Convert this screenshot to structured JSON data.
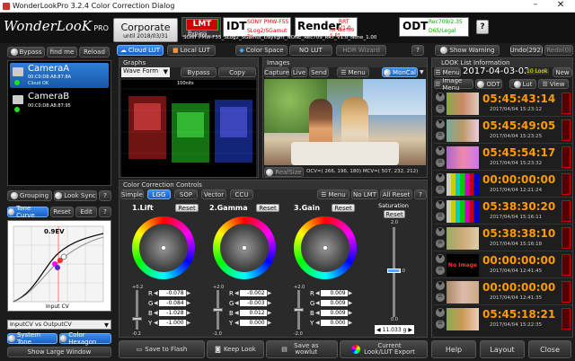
{
  "window": {
    "title": "WonderLookPro 3.2.4 Color Correction Dialog"
  },
  "brand": {
    "name": "WonderLooK",
    "suffix": "PRO"
  },
  "header": {
    "project": "Corporate",
    "expiry": "until 2018/03/31",
    "lmt": {
      "label": "LMT",
      "value": "Bypass"
    },
    "idt": {
      "label": "IDT",
      "line1": "SONY PMW-F55",
      "line2": "SLog2/SGamut DL"
    },
    "render": {
      "label": "Render",
      "line1": "RRT V1.0",
      "line2": "for Rec709 & P3"
    },
    "odt": {
      "label": "ODT",
      "line1": "Rec709/2.35",
      "line2": "D65/Legal"
    },
    "pipeline": "SONY PMW-F55_SLog2_SGamut_Daylight_NONE_Rec709_RRT_V1.0_None_1.00",
    "help": "?"
  },
  "topright": {
    "show_warning": "Show Warning",
    "undo": "Undo(292)",
    "redo": "Redo(0)"
  },
  "left": {
    "bypass": "Bypass",
    "findme": "find me",
    "reload": "Reload",
    "cameras": [
      {
        "name": "CameraA",
        "mac": "00:C0:D8:A8:87:8A",
        "status": "Cloud OK"
      },
      {
        "name": "CameraB",
        "mac": "00:C0:D8:A8:87:95"
      }
    ],
    "grouping": "Grouping",
    "looksync": "Look Sync",
    "help": "?",
    "tone_tab": "Tone Curve",
    "reset": "Reset",
    "edit": "Edit",
    "curve_ev": "0.9EV",
    "curve_xlabel": "Input CV",
    "mode_select": "InputCV vs OutputCV",
    "system_tone": "System Tone",
    "color_hexagon": "Color Hexagon",
    "large_window": "Show Large Window"
  },
  "tabs": {
    "cloud": "Cloud LUT",
    "local": "Local LUT",
    "space": "Color Space",
    "nolut": "NO LUT",
    "hdr": "HDR Wizard",
    "help": "?"
  },
  "graphs": {
    "title": "Graphs",
    "mode": "Wave Form",
    "bypass": "Bypass",
    "copy": "Copy",
    "scale_top": "100nits"
  },
  "images": {
    "title": "Images",
    "capture": "Capture",
    "live": "Live",
    "send": "Send",
    "menu": "Menu",
    "moncal": "MonCal",
    "realsize": "RealSize",
    "readout": "OCV=( 266, 196, 180) MCV=( 507, 232, 212)"
  },
  "cc": {
    "title": "Color Correction Controls",
    "tabs": [
      "Simple",
      "LGG",
      "SOP",
      "Vector",
      "CCU"
    ],
    "menu": "Menu",
    "nolut": "No LMT",
    "allreset": "All Reset",
    "help": "?",
    "wheels": [
      {
        "name": "1.Lift",
        "reset": "Reset",
        "r": "-0.078",
        "g": "-0.084",
        "b": "-1.028",
        "y": "-1.000",
        "top": "+0.2",
        "bot": "-0.2"
      },
      {
        "name": "2.Gamma",
        "reset": "Reset",
        "r": "-0.002",
        "g": "-0.003",
        "b": "0.012",
        "y": "0.000",
        "top": "+2.0",
        "bot": "-1.0"
      },
      {
        "name": "3.Gain",
        "reset": "Reset",
        "r": "0.009",
        "g": "0.009",
        "b": "0.009",
        "y": "0.000",
        "top": "+2.0",
        "bot": "-2.0"
      }
    ],
    "saturation": {
      "label": "Saturation",
      "reset": "Reset",
      "value": "11.033 g",
      "top": "2.0",
      "mid": "1.0",
      "bot": "0.0"
    }
  },
  "bottom": {
    "flash": "Save to Flash",
    "keeplook": "Keep Look",
    "wowlut": "Save as wowlut",
    "export": "Current Look/LUT Export"
  },
  "looklist": {
    "title": "LOOK List Information",
    "menu": "Menu",
    "date": "2017-04-03-02",
    "count": "10 Look",
    "new": "New",
    "image_menu": "Image Menu",
    "odt": "ODT",
    "lut": "Lut",
    "view": "View",
    "items": [
      {
        "time": "05:45:43:14",
        "date": "2017/04/04 15:23:12",
        "no_image": ""
      },
      {
        "time": "05:45:49:05",
        "date": "2017/04/04 15:23:25",
        "no_image": ""
      },
      {
        "time": "05:45:54:17",
        "date": "2017/04/04 15:23:32",
        "no_image": ""
      },
      {
        "time": "00:00:00:00",
        "date": "2017/04/04 12:21:24",
        "no_image": ""
      },
      {
        "time": "05:38:30:20",
        "date": "2017/04/04 15:16:11",
        "no_image": ""
      },
      {
        "time": "05:38:38:10",
        "date": "2017/04/04 15:16:18",
        "no_image": ""
      },
      {
        "time": "00:00:00:00",
        "date": "2017/04/04 12:41:45",
        "no_image": "No Image"
      },
      {
        "time": "00:00:00:00",
        "date": "2017/04/04 12:41:35",
        "no_image": ""
      },
      {
        "time": "05:45:18:21",
        "date": "2017/04/04 15:22:35",
        "no_image": ""
      }
    ],
    "help": "Help",
    "layout": "Layout",
    "close": "Close"
  }
}
